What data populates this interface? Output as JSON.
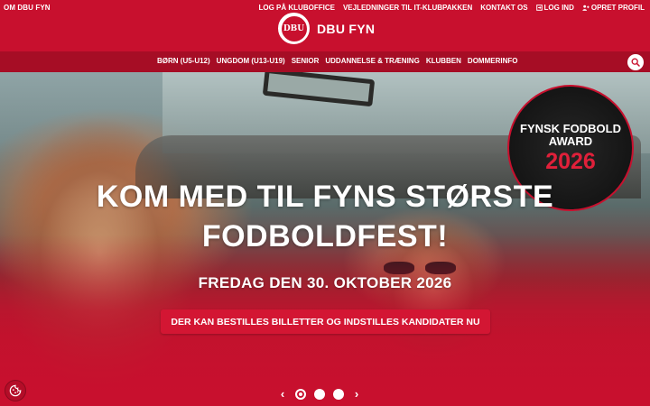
{
  "header": {
    "top_left_link": "OM DBU FYN",
    "top_links": [
      "LOG PÅ KLUBOFFICE",
      "VEJLEDNINGER TIL IT-KLUBPAKKEN",
      "KONTAKT OS",
      "LOG IND",
      "OPRET PROFIL"
    ],
    "logo_seal_text": "DBU",
    "logo_text": "DBU FYN"
  },
  "nav": {
    "items": [
      "BØRN (U5-U12)",
      "UNGDOM (U13-U19)",
      "SENIOR",
      "UDDANNELSE & TRÆNING",
      "KLUBBEN",
      "DOMMERINFO"
    ]
  },
  "hero": {
    "headline_line1": "KOM MED TIL FYNS STØRSTE",
    "headline_line2": "FODBOLDFEST!",
    "subhead": "FREDAG DEN 30. OKTOBER 2026",
    "cta_label": "DER KAN BESTILLES BILLETTER OG INDSTILLES KANDIDATER NU"
  },
  "award": {
    "line1": "FYNSK FODBOLD",
    "line2": "AWARD",
    "year": "2026"
  },
  "carousel": {
    "prev": "‹",
    "next": "›",
    "slide_count": 3,
    "active_index": 0
  },
  "colors": {
    "brand_red": "#c8102e",
    "nav_red": "#a60d25"
  },
  "icons": [
    "login-icon",
    "user-plus-icon",
    "search-icon",
    "cookie-icon",
    "chevron-left-icon",
    "chevron-right-icon"
  ]
}
